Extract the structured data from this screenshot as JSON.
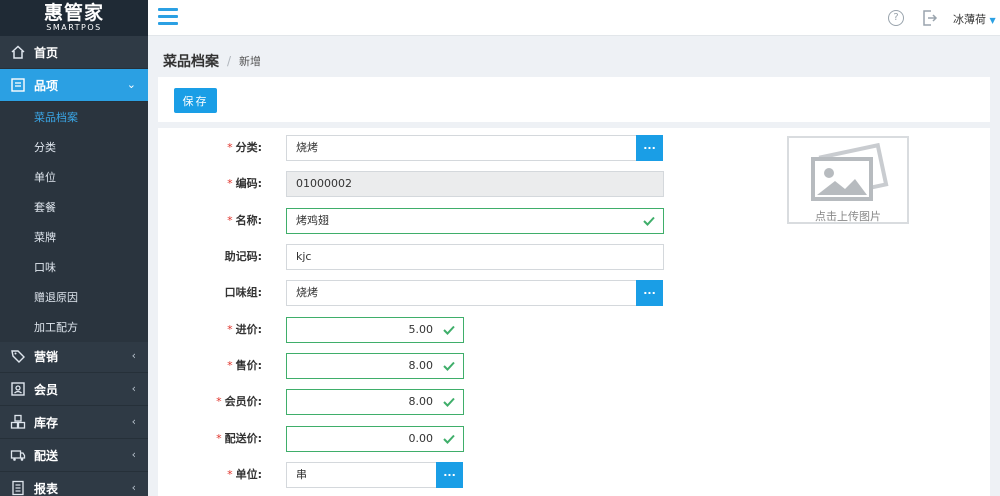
{
  "app": {
    "logo_main": "惠管家",
    "logo_sub": "SMARTPOS",
    "user": "冰薄荷"
  },
  "sidebar": {
    "items": [
      {
        "label": "首页",
        "icon": "home-icon"
      },
      {
        "label": "品项",
        "icon": "list-icon"
      },
      {
        "label": "营销",
        "icon": "tag-icon"
      },
      {
        "label": "会员",
        "icon": "member-card-icon"
      },
      {
        "label": "库存",
        "icon": "boxes-icon"
      },
      {
        "label": "配送",
        "icon": "delivery-icon"
      },
      {
        "label": "报表",
        "icon": "report-icon"
      }
    ],
    "subitems": [
      "菜品档案",
      "分类",
      "单位",
      "套餐",
      "菜牌",
      "口味",
      "赠退原因",
      "加工配方"
    ]
  },
  "breadcrumb": {
    "title": "菜品档案",
    "current": "新增"
  },
  "toolbar": {
    "save_label": "保存"
  },
  "form": {
    "category": {
      "label": "分类:",
      "value": "烧烤",
      "btn": "..."
    },
    "code": {
      "label": "编码:",
      "value": "01000002"
    },
    "name": {
      "label": "名称:",
      "value": "烤鸡翅"
    },
    "mnemonic": {
      "label": "助记码:",
      "value": "kjc"
    },
    "flavor_group": {
      "label": "口味组:",
      "value": "烧烤",
      "btn": "..."
    },
    "purchase_price": {
      "label": "进价:",
      "value": "5.00"
    },
    "sale_price": {
      "label": "售价:",
      "value": "8.00"
    },
    "member_price": {
      "label": "会员价:",
      "value": "8.00"
    },
    "delivery_price": {
      "label": "配送价:",
      "value": "0.00"
    },
    "unit": {
      "label": "单位:",
      "value": "串",
      "btn": "..."
    },
    "required_mark": "*"
  },
  "upload": {
    "label": "点击上传图片"
  },
  "colors": {
    "accent": "#1a9ee6",
    "sidebar_bg": "#2f3a45",
    "valid": "#3fae6a",
    "required": "#e0332b"
  }
}
